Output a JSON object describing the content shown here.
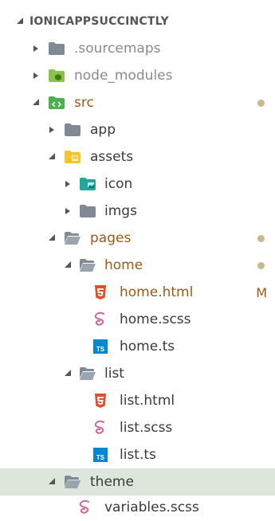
{
  "explorer": {
    "root_label": "IONICAPPSUCCINCTLY",
    "items": [
      {
        "label": ".sourcemaps"
      },
      {
        "label": "node_modules"
      },
      {
        "label": "src"
      },
      {
        "label": "app"
      },
      {
        "label": "assets"
      },
      {
        "label": "icon"
      },
      {
        "label": "imgs"
      },
      {
        "label": "pages"
      },
      {
        "label": "home"
      },
      {
        "label": "home.html",
        "badge": "M"
      },
      {
        "label": "home.scss"
      },
      {
        "label": "home.ts"
      },
      {
        "label": "list"
      },
      {
        "label": "list.html"
      },
      {
        "label": "list.scss"
      },
      {
        "label": "list.ts"
      },
      {
        "label": "theme"
      },
      {
        "label": "variables.scss"
      }
    ]
  },
  "colors": {
    "folder_gray": "#7f8a96",
    "modified_text": "#9a5a16",
    "selected_bg": "#dde6da",
    "html_icon": "#e44d26",
    "scss_icon": "#cd6799",
    "ts_icon": "#0288d1",
    "src_icon": "#4caf50",
    "assets_icon": "#f9c32b",
    "icon_folder": "#26a69a"
  },
  "icons": {
    "folder": "folder-icon",
    "folder_open": "folder-open-icon",
    "html": "html5-icon",
    "scss": "sass-icon",
    "ts": "typescript-icon"
  }
}
